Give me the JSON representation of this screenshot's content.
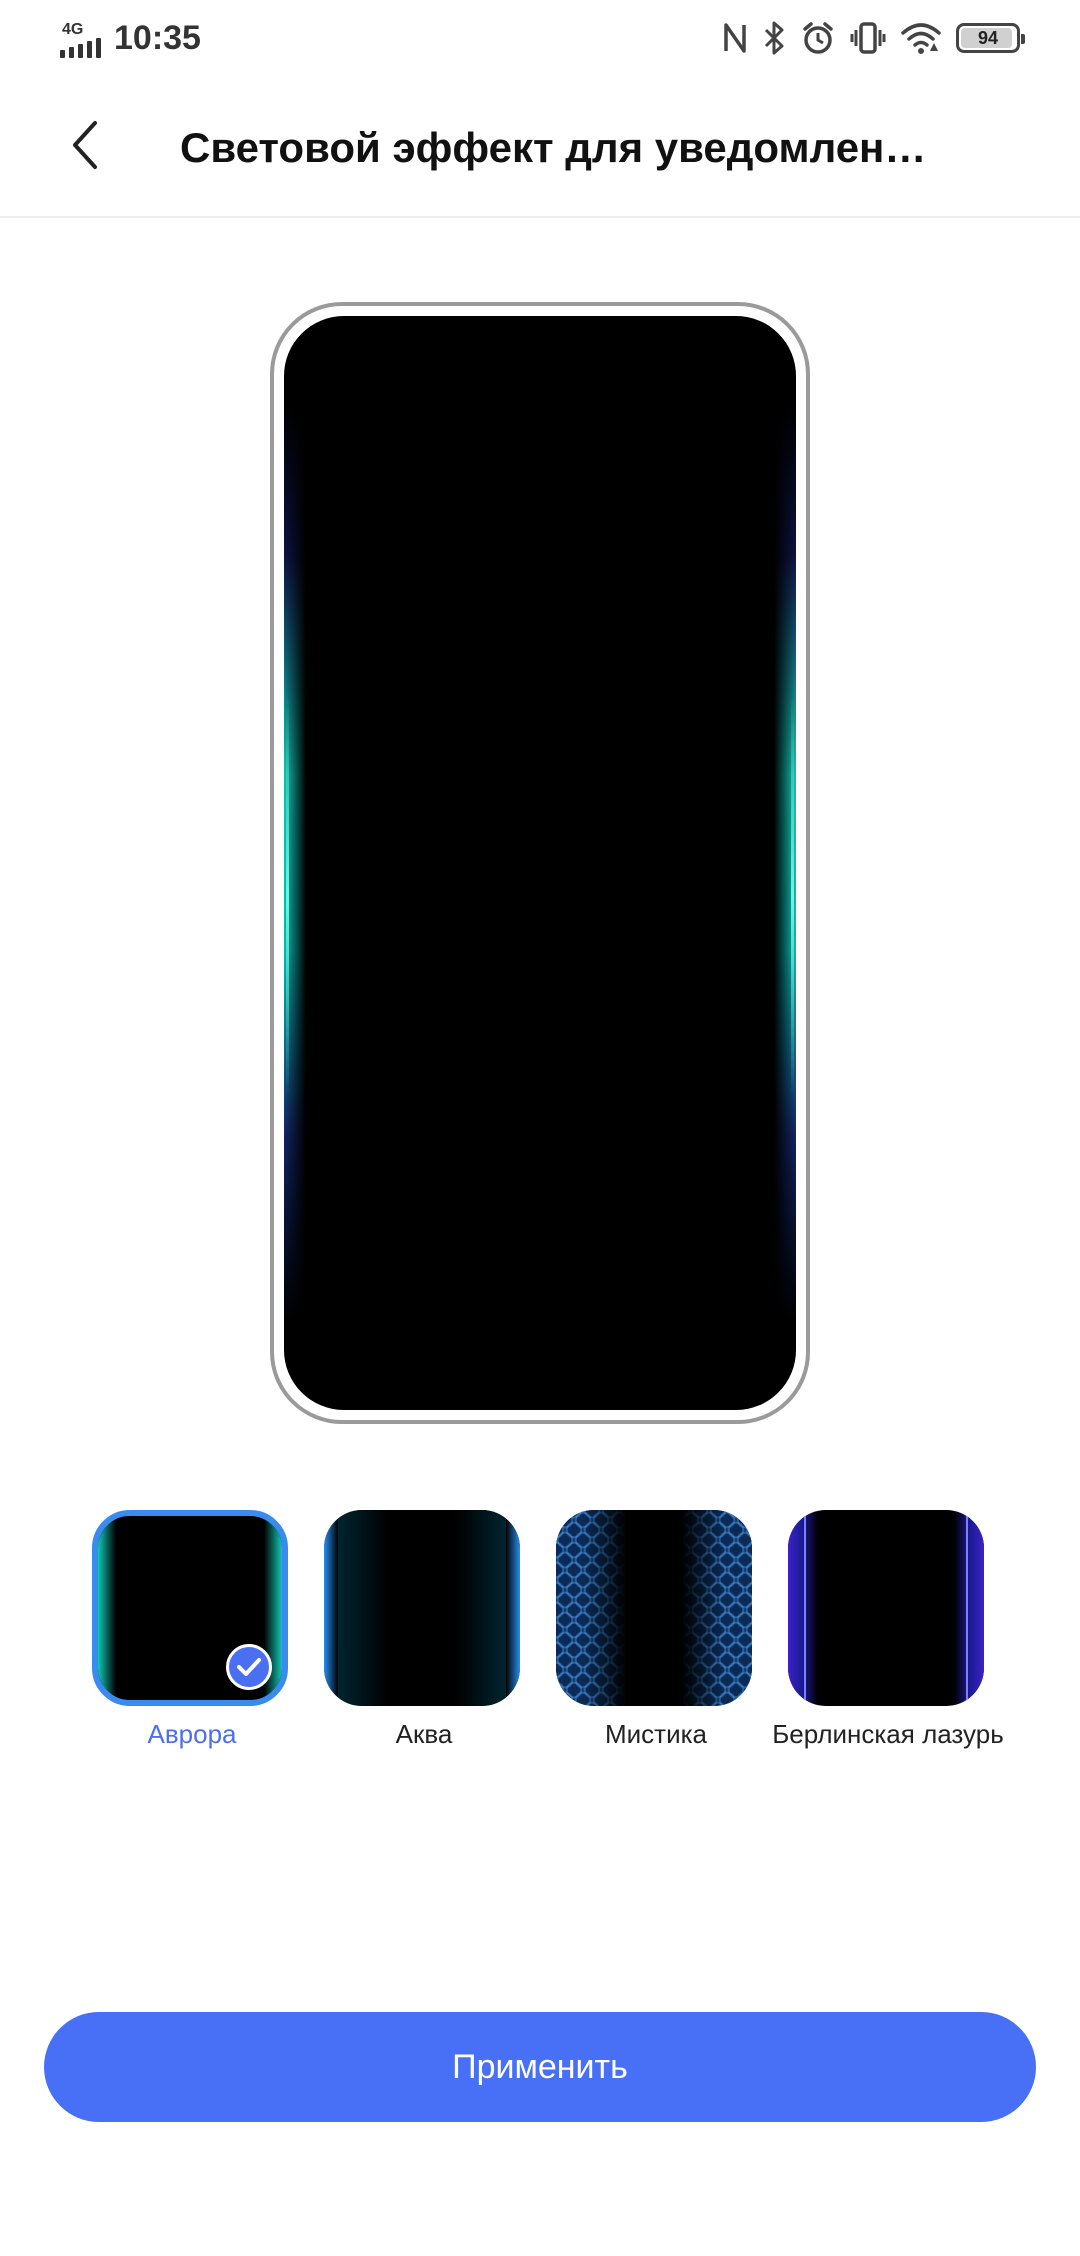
{
  "status_bar": {
    "network": "4G",
    "time": "10:35",
    "battery": "94",
    "battery_level_percent": 94,
    "icons": [
      "nfc-icon",
      "bluetooth-icon",
      "alarm-icon",
      "vibrate-icon",
      "wifi-icon",
      "battery-icon"
    ]
  },
  "header": {
    "title": "Световой эффект для уведомлен…",
    "back_icon": "chevron-left-icon"
  },
  "preview": {
    "effect": "Аврора",
    "glow_color": "#14dcc8"
  },
  "effects": {
    "items": [
      {
        "label": "Аврора",
        "selected": true
      },
      {
        "label": "Аква",
        "selected": false
      },
      {
        "label": "Мистика",
        "selected": false
      },
      {
        "label": "Берлинская лазурь",
        "selected": false
      }
    ]
  },
  "apply": {
    "label": "Применить"
  },
  "colors": {
    "accent": "#4870f6",
    "selected_label": "#4d6ef0",
    "selected_border": "#3a8bf0"
  }
}
